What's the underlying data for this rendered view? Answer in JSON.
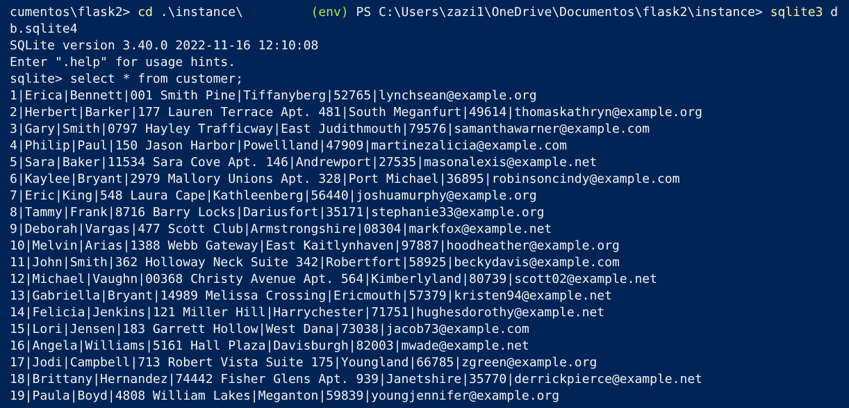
{
  "terminal": {
    "prompt1": "cumentos\\flask2> ",
    "cmd1": "cd",
    "cmd1_args": " .\\instance\\         ",
    "env_label": "(env)",
    "prompt2": " PS C:\\Users\\zazi1\\OneDrive\\Documentos\\flask2\\instance> ",
    "cmd2": "sqlite3",
    "cmd2_args_part1": " d",
    "cmd2_args_part2": "b.sqlite4",
    "version_line": "SQLite version 3.40.0 2022-11-16 12:10:08",
    "hint_line": "Enter \".help\" for usage hints.",
    "sql_prompt": "sqlite> select * from customer;",
    "rows": [
      "1|Erica|Bennett|001 Smith Pine|Tiffanyberg|52765|lynchsean@example.org",
      "2|Herbert|Barker|177 Lauren Terrace Apt. 481|South Meganfurt|49614|thomaskathryn@example.org",
      "3|Gary|Smith|0797 Hayley Trafficway|East Judithmouth|79576|samanthawarner@example.com",
      "4|Philip|Paul|150 Jason Harbor|Powellland|47909|martinezalicia@example.com",
      "5|Sara|Baker|11534 Sara Cove Apt. 146|Andrewport|27535|masonalexis@example.net",
      "6|Kaylee|Bryant|2979 Mallory Unions Apt. 328|Port Michael|36895|robinsoncindy@example.com",
      "7|Eric|King|548 Laura Cape|Kathleenberg|56440|joshuamurphy@example.org",
      "8|Tammy|Frank|8716 Barry Locks|Dariusfort|35171|stephanie33@example.org",
      "9|Deborah|Vargas|477 Scott Club|Armstrongshire|08304|markfox@example.net",
      "10|Melvin|Arias|1388 Webb Gateway|East Kaitlynhaven|97887|hoodheather@example.org",
      "11|John|Smith|362 Holloway Neck Suite 342|Robertfort|58925|beckydavis@example.com",
      "12|Michael|Vaughn|00368 Christy Avenue Apt. 564|Kimberlyland|80739|scott02@example.net",
      "13|Gabriella|Bryant|14989 Melissa Crossing|Ericmouth|57379|kristen94@example.net",
      "14|Felicia|Jenkins|121 Miller Hill|Harrychester|71751|hughesdorothy@example.net",
      "15|Lori|Jensen|183 Garrett Hollow|West Dana|73038|jacob73@example.com",
      "16|Angela|Williams|5161 Hall Plaza|Davisburgh|82003|mwade@example.net",
      "17|Jodi|Campbell|713 Robert Vista Suite 175|Youngland|66785|zgreen@example.org",
      "18|Brittany|Hernandez|74442 Fisher Glens Apt. 939|Janetshire|35770|derrickpierce@example.net",
      "19|Paula|Boyd|4808 William Lakes|Meganton|59839|youngjennifer@example.org"
    ]
  },
  "colors": {
    "background": "#012456",
    "text": "#f2f2f2",
    "command": "#fff39e",
    "env": "#b4e24a"
  }
}
